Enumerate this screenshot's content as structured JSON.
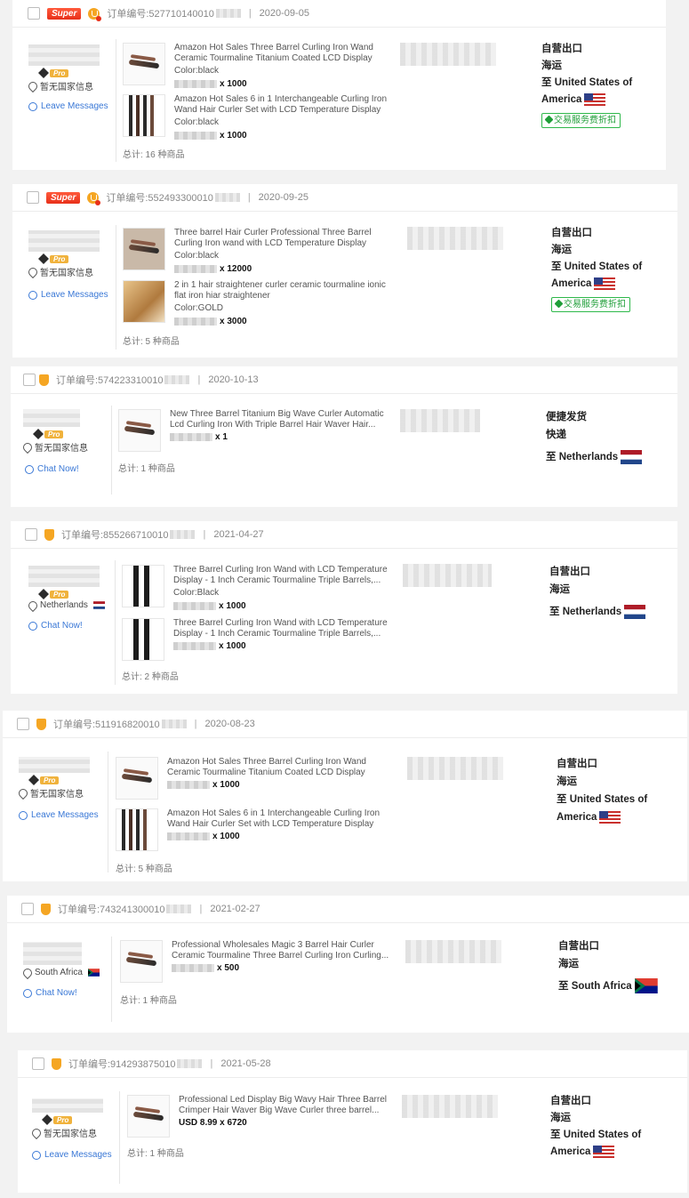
{
  "orders": [
    {
      "badge": "Super",
      "order_label": "订单编号:527710140010",
      "date": "2020-09-05",
      "country_info": "暂无国家信息",
      "contact_label": "Leave Messages",
      "items": [
        {
          "title": "Amazon Hot Sales Three Barrel Curling Iron Wand Ceramic Tourmaline Titanium Coated LCD Display",
          "color": "Color:black",
          "qty": "x 1000",
          "icon": "curling-wand"
        },
        {
          "title": "Amazon Hot Sales 6 in 1 Interchangeable Curling Iron Wand Hair Curler Set with LCD Temperature Display",
          "color": "Color:black",
          "qty": "x 1000",
          "icon": "curler-set"
        }
      ],
      "total": "总计: 16 种商品",
      "ship_type": "自营出口",
      "ship_mode": "海运",
      "destination": "至 United States of America",
      "flag": "us",
      "service_tag": "交易服务费折扣"
    },
    {
      "badge": "Super",
      "order_label": "订单编号:552493300010",
      "date": "2020-09-25",
      "country_info": "暂无国家信息",
      "contact_label": "Leave Messages",
      "items": [
        {
          "title": "Three barrel Hair Curler Professional Three Barrel Curling Iron wand with LCD Temperature Display",
          "color": "Color:black",
          "qty": "x 12000",
          "icon": "curling-wand"
        },
        {
          "title": "2 in 1 hair straightener curler ceramic tourmaline ionic flat iron hiar straightener",
          "color": "Color:GOLD",
          "qty": "x 3000",
          "icon": "straightener"
        }
      ],
      "total": "总计: 5 种商品",
      "ship_type": "自营出口",
      "ship_mode": "海运",
      "destination": "至 United States of America",
      "flag": "us",
      "service_tag": "交易服务费折扣"
    },
    {
      "badge": "",
      "order_label": "订单编号:574223310010",
      "date": "2020-10-13",
      "country_info": "暂无国家信息",
      "contact_label": "Chat Now!",
      "items": [
        {
          "title": "New Three Barrel Titanium Big Wave Curler Automatic Lcd Curling Iron With Triple Barrel Hair Waver Hair...",
          "color": "",
          "qty": "x 1",
          "icon": "curling-wand"
        }
      ],
      "total": "总计: 1 种商品",
      "ship_type": "便捷发货",
      "ship_mode": "快递",
      "destination": "至 Netherlands",
      "flag": "nl",
      "service_tag": ""
    },
    {
      "badge": "",
      "order_label": "订单编号:855266710010",
      "date": "2021-04-27",
      "country_info": "Netherlands",
      "contact_label": "Chat Now!",
      "items": [
        {
          "title": "Three Barrel Curling Iron Wand with LCD Temperature Display - 1 Inch Ceramic Tourmaline Triple Barrels,...",
          "color": "Color:Black",
          "qty": "x 1000",
          "icon": "curling-black"
        },
        {
          "title": "Three Barrel Curling Iron Wand with LCD Temperature Display - 1 Inch Ceramic Tourmaline Triple Barrels,...",
          "color": "",
          "qty": "x 1000",
          "icon": "curling-black"
        }
      ],
      "total": "总计: 2 种商品",
      "ship_type": "自营出口",
      "ship_mode": "海运",
      "destination": "至 Netherlands",
      "flag": "nl",
      "service_tag": ""
    },
    {
      "badge": "",
      "order_label": "订单编号:511916820010",
      "date": "2020-08-23",
      "country_info": "暂无国家信息",
      "contact_label": "Leave Messages",
      "items": [
        {
          "title": "Amazon Hot Sales Three Barrel Curling Iron Wand Ceramic Tourmaline Titanium Coated LCD Display",
          "color": "",
          "qty": "x 1000",
          "icon": "curling-wand"
        },
        {
          "title": "Amazon Hot Sales 6 in 1 Interchangeable Curling Iron Wand Hair Curler Set with LCD Temperature Display",
          "color": "",
          "qty": "x 1000",
          "icon": "curler-set"
        }
      ],
      "total": "总计: 5 种商品",
      "ship_type": "自营出口",
      "ship_mode": "海运",
      "destination": "至 United States of America",
      "flag": "us",
      "service_tag": ""
    },
    {
      "badge": "",
      "order_label": "订单编号:743241300010",
      "date": "2021-02-27",
      "country_info": "South Africa",
      "contact_label": "Chat Now!",
      "items": [
        {
          "title": "Professional Wholesales Magic 3 Barrel Hair Curler Ceramic Tourmaline Three Barrel Curling Iron Curling...",
          "color": "",
          "qty": "x 500",
          "icon": "curling-wand"
        }
      ],
      "total": "总计: 1 种商品",
      "ship_type": "自营出口",
      "ship_mode": "海运",
      "destination": "至 South Africa",
      "flag": "za",
      "service_tag": ""
    },
    {
      "badge": "",
      "order_label": "订单编号:914293875010",
      "date": "2021-05-28",
      "country_info": "暂无国家信息",
      "contact_label": "Leave Messages",
      "items": [
        {
          "title": "Professional Led Display Big Wavy Hair Three Barrel Crimper Hair Waver Big Wave Curler three barrel...",
          "color": "",
          "qty": "USD 8.99 x 6720",
          "icon": "curling-wand"
        }
      ],
      "total": "总计: 1 种商品",
      "ship_type": "自营出口",
      "ship_mode": "海运",
      "destination": "至 United States of America",
      "flag": "us",
      "service_tag": ""
    }
  ]
}
